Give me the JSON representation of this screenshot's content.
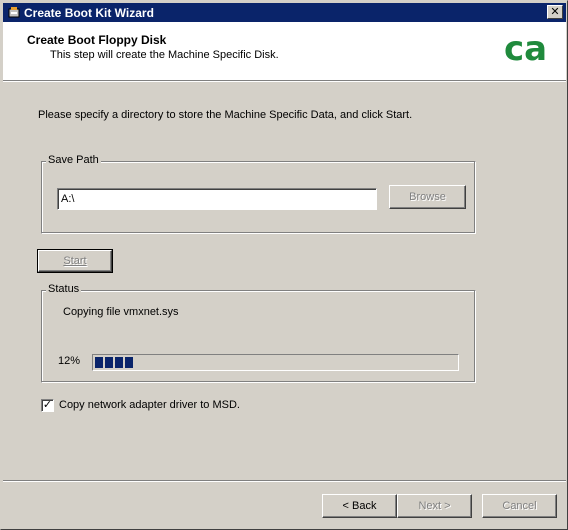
{
  "window": {
    "title": "Create Boot Kit Wizard",
    "close_glyph": "✕"
  },
  "header": {
    "title": "Create Boot Floppy Disk",
    "subtitle": "This step will create the Machine Specific Disk.",
    "logo_text": "ca"
  },
  "instruction": "Please specify a directory to store the Machine Specific Data, and click Start.",
  "save_path": {
    "group_label": "Save Path",
    "value": "A:\\",
    "browse_label": "Browse"
  },
  "start_label": "Start",
  "status": {
    "group_label": "Status",
    "message": "Copying file vmxnet.sys",
    "percent_text": "12%",
    "progress_fraction": 0.12
  },
  "copy_driver": {
    "label": "Copy network adapter driver to MSD.",
    "checked": true,
    "check_glyph": "✓"
  },
  "nav": {
    "back_label": "< Back",
    "next_label": "Next >",
    "cancel_label": "Cancel"
  },
  "colors": {
    "titlebar": "#0a246a",
    "progress": "#0a246a",
    "face": "#d4d0c8",
    "logo": "#1f8a3c"
  }
}
